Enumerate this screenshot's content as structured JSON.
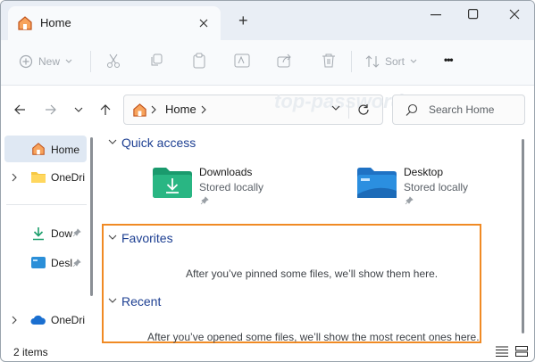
{
  "window": {
    "tab_title": "Home",
    "new_tab_symbol": "+",
    "controls": {
      "minimize": "minimize-icon",
      "maximize": "maximize-icon",
      "close": "close-icon"
    }
  },
  "toolbar": {
    "new_label": "New",
    "sort_label": "Sort",
    "more_symbol": "•••"
  },
  "address": {
    "breadcrumb": "Home",
    "search_placeholder": "Search Home"
  },
  "watermark": "top-password.com",
  "sidebar": {
    "items": [
      {
        "label": "Home",
        "selected": true
      },
      {
        "label": "OneDri"
      },
      {
        "label": "Dow"
      },
      {
        "label": "Desl"
      },
      {
        "label": "OneDri"
      }
    ]
  },
  "quick_access": {
    "title": "Quick access",
    "items": [
      {
        "name": "Downloads",
        "sub": "Stored locally"
      },
      {
        "name": "Desktop",
        "sub": "Stored locally"
      }
    ]
  },
  "favorites": {
    "title": "Favorites",
    "empty_text": "After you’ve pinned some files, we’ll show them here."
  },
  "recent": {
    "title": "Recent",
    "empty_text": "After you’ve opened some files, we’ll show the most recent ones here."
  },
  "status": {
    "items_count": "2 items"
  },
  "colors": {
    "highlight_border": "#f08a24",
    "section_title": "#1d3f92",
    "selected_bg": "#dfe8f3"
  }
}
